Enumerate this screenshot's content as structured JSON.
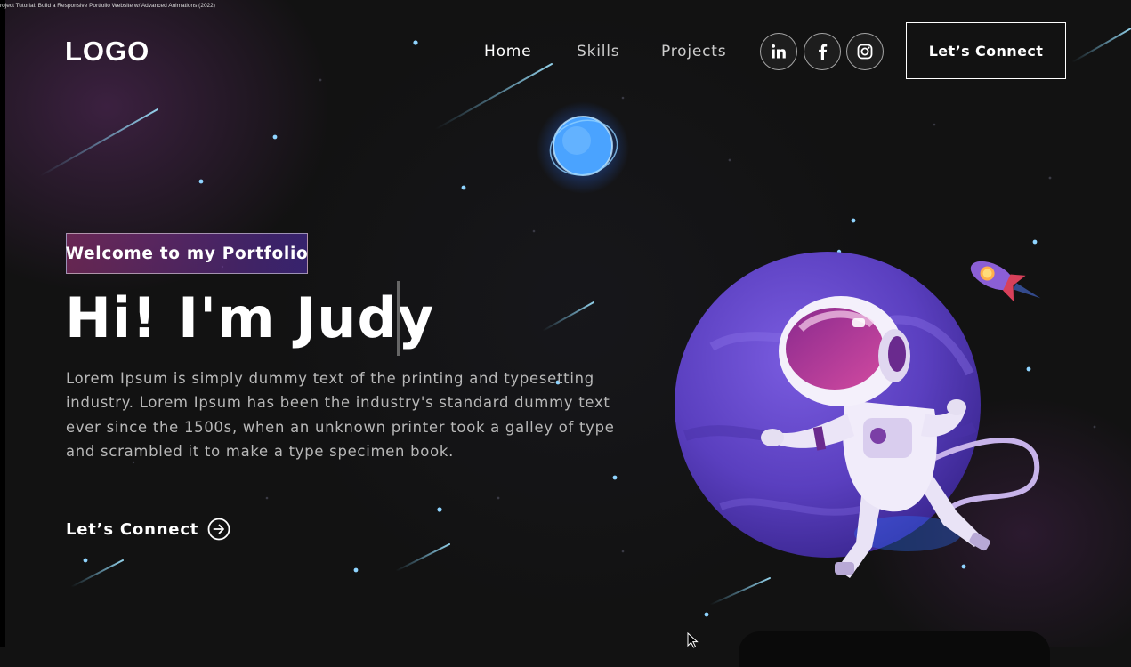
{
  "video_title": "roject Tutorial: Build a Responsive Portfolio Website w/ Advanced Animations (2022)",
  "logo": "LOGO",
  "nav": {
    "links": [
      {
        "label": "Home",
        "active": true
      },
      {
        "label": "Skills",
        "active": false
      },
      {
        "label": "Projects",
        "active": false
      }
    ],
    "social_icons": [
      "linkedin-icon",
      "facebook-icon",
      "instagram-icon"
    ],
    "connect_label": "Let’s Connect"
  },
  "banner": {
    "tagline": "Welcome to my Portfolio",
    "headline": "Hi! I'm Judy",
    "description": "Lorem Ipsum is simply dummy text of the printing and typesetting industry. Lorem Ipsum has been the industry's standard dummy text ever since the 1500s, when an unknown printer took a galley of type and scrambled it to make a type specimen book.",
    "cta_label": "Let’s Connect"
  },
  "colors": {
    "background": "#121212",
    "tagline_gradient_start": "#AA367C",
    "tagline_gradient_end": "#4A2FBD",
    "planet": "#5B3FBF",
    "text_muted": "#B8B8B8"
  }
}
